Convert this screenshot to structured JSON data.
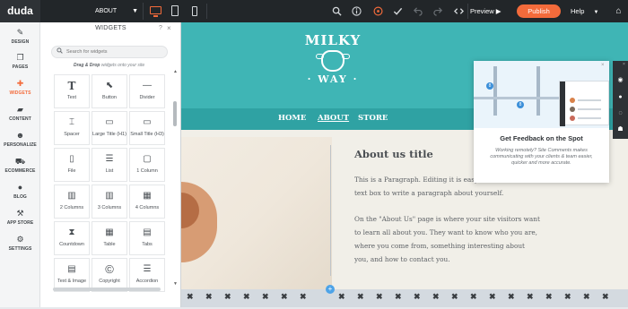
{
  "topbar": {
    "logo": "duda",
    "page_select": "ABOUT",
    "preview_label": "Preview ▶",
    "publish_label": "Publish",
    "help_label": "Help",
    "icons": [
      "desktop-icon",
      "tablet-icon",
      "mobile-icon",
      "search-icon",
      "info-icon",
      "feedback-icon",
      "check-icon",
      "undo-icon",
      "redo-icon",
      "code-icon",
      "home-icon"
    ]
  },
  "leftnav": {
    "items": [
      {
        "label": "DESIGN",
        "icon": "✎"
      },
      {
        "label": "PAGES",
        "icon": "❐"
      },
      {
        "label": "WIDGETS",
        "icon": "✚"
      },
      {
        "label": "CONTENT",
        "icon": "▰"
      },
      {
        "label": "PERSONALIZE",
        "icon": "☻"
      },
      {
        "label": "ECOMMERCE",
        "icon": "⛟"
      },
      {
        "label": "BLOG",
        "icon": "●"
      },
      {
        "label": "APP STORE",
        "icon": "⚒"
      },
      {
        "label": "SETTINGS",
        "icon": "⚙"
      }
    ]
  },
  "panel": {
    "title": "WIDGETS",
    "help": "?",
    "close": "×",
    "search_placeholder": "Search for widgets",
    "hint_bold": "Drag & Drop",
    "hint_rest": " widgets onto your site",
    "widgets": [
      {
        "label": "Text",
        "icon": "T"
      },
      {
        "label": "Button",
        "icon": "⬉"
      },
      {
        "label": "Divider",
        "icon": "—"
      },
      {
        "label": "Spacer",
        "icon": "⌶"
      },
      {
        "label": "Large Title (H1)",
        "icon": "▭"
      },
      {
        "label": "Small Title (H3)",
        "icon": "▭"
      },
      {
        "label": "File",
        "icon": "▯"
      },
      {
        "label": "List",
        "icon": "☰"
      },
      {
        "label": "1 Column",
        "icon": "▢"
      },
      {
        "label": "2 Columns",
        "icon": "▥"
      },
      {
        "label": "3 Columns",
        "icon": "▥"
      },
      {
        "label": "4 Columns",
        "icon": "▦"
      },
      {
        "label": "Countdown",
        "icon": "⧗"
      },
      {
        "label": "Table",
        "icon": "▦"
      },
      {
        "label": "Tabs",
        "icon": "▤"
      },
      {
        "label": "Text & Image",
        "icon": "▤"
      },
      {
        "label": "Copyright",
        "icon": "©"
      },
      {
        "label": "Accordion",
        "icon": "☰"
      }
    ]
  },
  "site": {
    "logo_top": "MILKY",
    "logo_bottom": "· WAY ·",
    "nav": [
      "HOME",
      "ABOUT",
      "STORE"
    ],
    "about_title": "About us title",
    "about_lines": [
      "This is a Paragraph. Editing it is easy. I",
      "text box to write a paragraph about yourself.",
      "On the \"About Us\" page is where your site visitors want",
      "to learn all about you. They want to know who you are,",
      "where you come from, something interesting about",
      "you, and how to contact you."
    ]
  },
  "popup": {
    "title": "Get Feedback on the Spot",
    "text": "Working remotely? Site Comments makes communicating with your clients & team easier, quicker and more accurate.",
    "close": "×",
    "pin1": "8",
    "pin2": "8"
  },
  "colors": {
    "accent": "#f36b3b",
    "teal": "#3fb5b5",
    "teal_dark": "#2fa2a3",
    "topbar": "#222629"
  }
}
